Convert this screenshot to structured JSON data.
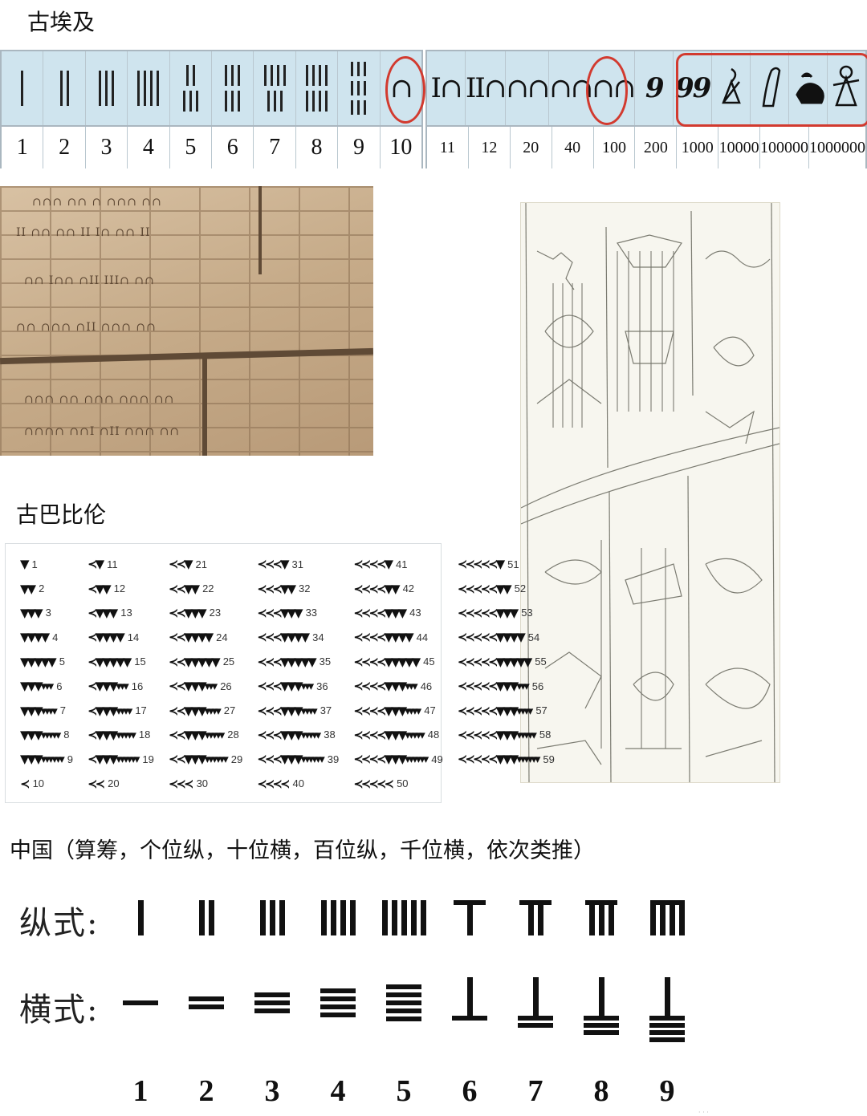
{
  "sections": {
    "egypt": "古埃及",
    "babylon": "古巴比伦",
    "china": "中国（算筹，个位纵，十位横，百位纵，千位横，依次类推）"
  },
  "egypt_table_1": {
    "numbers": [
      "1",
      "2",
      "3",
      "4",
      "5",
      "6",
      "7",
      "8",
      "9",
      "10"
    ],
    "glyphs": [
      "I",
      "II",
      "III",
      "IIII",
      "II/III",
      "III/III",
      "IIII/III",
      "IIII/IIII",
      "III/III/III",
      "∩"
    ],
    "highlight_color": "#d23a2f"
  },
  "egypt_table_2": {
    "numbers": [
      "11",
      "12",
      "20",
      "40",
      "100",
      "200",
      "1000",
      "10000",
      "100000",
      "1000000"
    ],
    "glyphs": [
      "I∩",
      "II∩",
      "∩∩",
      "∩∩∩∩",
      "9",
      "99",
      "lotus-icon",
      "finger-icon",
      "tadpole-icon",
      "god-icon"
    ]
  },
  "babylon_table": {
    "numbers": [
      "1",
      "2",
      "3",
      "4",
      "5",
      "6",
      "7",
      "8",
      "9",
      "10",
      "11",
      "12",
      "13",
      "14",
      "15",
      "16",
      "17",
      "18",
      "19",
      "20",
      "21",
      "22",
      "23",
      "24",
      "25",
      "26",
      "27",
      "28",
      "29",
      "30",
      "31",
      "32",
      "33",
      "34",
      "35",
      "36",
      "37",
      "38",
      "39",
      "40",
      "41",
      "42",
      "43",
      "44",
      "45",
      "46",
      "47",
      "48",
      "49",
      "50",
      "51",
      "52",
      "53",
      "54",
      "55",
      "56",
      "57",
      "58",
      "59"
    ]
  },
  "china_rods": {
    "vertical_label": "纵式:",
    "horizontal_label": "横式:",
    "numbers": [
      "1",
      "2",
      "3",
      "4",
      "5",
      "6",
      "7",
      "8",
      "9"
    ]
  }
}
